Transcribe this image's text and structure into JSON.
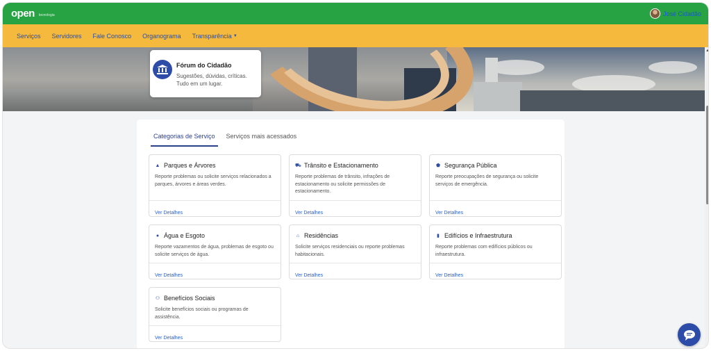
{
  "header": {
    "logo_text": "open",
    "logo_subtext": "tecnologia",
    "user_name": "José Cidadão"
  },
  "nav": {
    "items": [
      {
        "label": "Serviços"
      },
      {
        "label": "Servidores"
      },
      {
        "label": "Fale Conosco"
      },
      {
        "label": "Organograma"
      },
      {
        "label": "Transparência",
        "has_dropdown": true
      }
    ]
  },
  "hero": {
    "card_title": "Fórum do Cidadão",
    "card_line1": "Sugestões, dúvidas, críticas.",
    "card_line2": "Tudo em um lugar."
  },
  "tabs": [
    {
      "label": "Categorias de Serviço",
      "active": true
    },
    {
      "label": "Serviços mais acessados",
      "active": false
    }
  ],
  "link_label": "Ver Detalhes",
  "categories": [
    {
      "icon": "tree-icon",
      "glyph": "▲",
      "title": "Parques e Árvores",
      "description": "Reporte problemas ou solicite serviços relacionados a parques, árvores e áreas verdes."
    },
    {
      "icon": "car-icon",
      "glyph": "⛟",
      "title": "Trânsito e Estacionamento",
      "description": "Reporte problemas de trânsito, infrações de estacionamento ou solicite permissões de estacionamento."
    },
    {
      "icon": "shield-icon",
      "glyph": "⬟",
      "title": "Segurança Pública",
      "description": "Reporte preocupações de segurança ou solicite serviços de emergência."
    },
    {
      "icon": "water-drop-icon",
      "glyph": "●",
      "title": "Água e Esgoto",
      "description": "Reporte vazamentos de água, problemas de esgoto ou solicite serviços de água."
    },
    {
      "icon": "home-icon",
      "glyph": "⌂",
      "title": "Residências",
      "description": "Solicite serviços residenciais ou reporte problemas habitacionais."
    },
    {
      "icon": "building-icon",
      "glyph": "▮",
      "title": "Edifícios e Infraestrutura",
      "description": "Reporte problemas com edifícios públicos ou infraestrutura."
    },
    {
      "icon": "people-icon",
      "glyph": "⚇",
      "title": "Benefícios Sociais",
      "description": "Solicite benefícios sociais ou programas de assistência."
    }
  ],
  "colors": {
    "topbar": "#27a344",
    "navbar": "#f5b93d",
    "primary": "#2d4ca8",
    "link": "#2b5fc4"
  }
}
